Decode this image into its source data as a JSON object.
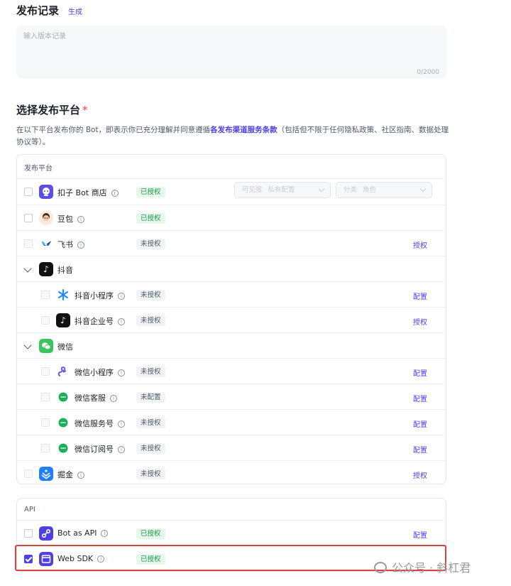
{
  "release": {
    "title": "发布记录",
    "generate_label": "生成",
    "placeholder": "输入版本记录",
    "counter": "0/2000"
  },
  "platform_section": {
    "title": "选择发布平台",
    "required_mark": "*",
    "desc_before": "在以下平台发布你的 Bot，即表示你已充分理解并同意遵循",
    "desc_link": "各发布渠道服务条款",
    "desc_after": "（包括但不限于任何隐私政策、社区指南、数据处理协议等）。"
  },
  "publish_card": {
    "header": "发布平台",
    "coze_store": {
      "name": "扣子 Bot 商店",
      "status": "已授权",
      "visibility_label": "可见度",
      "visibility_value": "私有配置",
      "category_label": "分类",
      "category_value": "角色"
    },
    "doubao": {
      "name": "豆包",
      "status": "已授权"
    },
    "feishu": {
      "name": "飞书",
      "status": "未授权",
      "action": "授权"
    },
    "douyin": {
      "group": "抖音"
    },
    "douyin_miniapp": {
      "name": "抖音小程序",
      "status": "未授权",
      "action": "配置"
    },
    "douyin_enterprise": {
      "name": "抖音企业号",
      "status": "未授权",
      "action": "授权"
    },
    "wechat": {
      "group": "微信"
    },
    "wechat_miniapp": {
      "name": "微信小程序",
      "status": "未授权",
      "action": "配置"
    },
    "wechat_service": {
      "name": "微信客服",
      "status": "未配置",
      "action": "配置"
    },
    "wechat_official": {
      "name": "微信服务号",
      "status": "未授权",
      "action": "配置"
    },
    "wechat_subscription": {
      "name": "微信订阅号",
      "status": "未授权",
      "action": "配置"
    },
    "juejin": {
      "name": "掘金",
      "status": "未授权",
      "action": "授权"
    }
  },
  "api_card": {
    "header": "API",
    "bot_api": {
      "name": "Bot as API",
      "status": "已授权",
      "action": "配置"
    },
    "web_sdk": {
      "name": "Web SDK",
      "status": "已授权"
    }
  },
  "watermark": "公众号 · 斜杠君",
  "colors": {
    "accent": "#4e40e5",
    "authorized": "#1a9b4b",
    "highlight": "#e0403d"
  }
}
